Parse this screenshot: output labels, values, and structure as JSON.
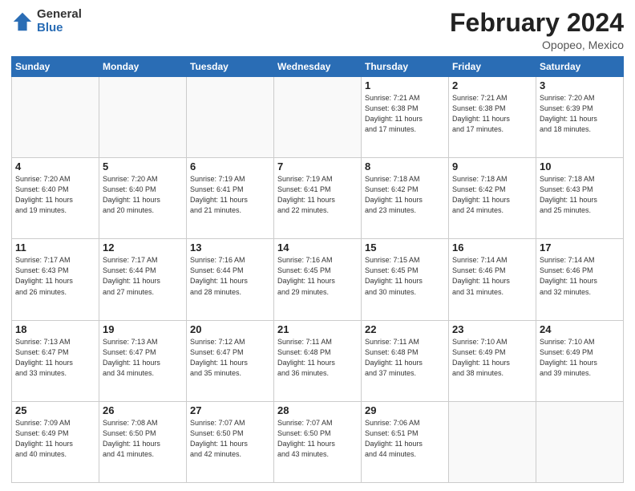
{
  "header": {
    "logo_general": "General",
    "logo_blue": "Blue",
    "title": "February 2024",
    "location": "Opopeo, Mexico"
  },
  "days_of_week": [
    "Sunday",
    "Monday",
    "Tuesday",
    "Wednesday",
    "Thursday",
    "Friday",
    "Saturday"
  ],
  "weeks": [
    [
      {
        "day": "",
        "info": ""
      },
      {
        "day": "",
        "info": ""
      },
      {
        "day": "",
        "info": ""
      },
      {
        "day": "",
        "info": ""
      },
      {
        "day": "1",
        "info": "Sunrise: 7:21 AM\nSunset: 6:38 PM\nDaylight: 11 hours\nand 17 minutes."
      },
      {
        "day": "2",
        "info": "Sunrise: 7:21 AM\nSunset: 6:38 PM\nDaylight: 11 hours\nand 17 minutes."
      },
      {
        "day": "3",
        "info": "Sunrise: 7:20 AM\nSunset: 6:39 PM\nDaylight: 11 hours\nand 18 minutes."
      }
    ],
    [
      {
        "day": "4",
        "info": "Sunrise: 7:20 AM\nSunset: 6:40 PM\nDaylight: 11 hours\nand 19 minutes."
      },
      {
        "day": "5",
        "info": "Sunrise: 7:20 AM\nSunset: 6:40 PM\nDaylight: 11 hours\nand 20 minutes."
      },
      {
        "day": "6",
        "info": "Sunrise: 7:19 AM\nSunset: 6:41 PM\nDaylight: 11 hours\nand 21 minutes."
      },
      {
        "day": "7",
        "info": "Sunrise: 7:19 AM\nSunset: 6:41 PM\nDaylight: 11 hours\nand 22 minutes."
      },
      {
        "day": "8",
        "info": "Sunrise: 7:18 AM\nSunset: 6:42 PM\nDaylight: 11 hours\nand 23 minutes."
      },
      {
        "day": "9",
        "info": "Sunrise: 7:18 AM\nSunset: 6:42 PM\nDaylight: 11 hours\nand 24 minutes."
      },
      {
        "day": "10",
        "info": "Sunrise: 7:18 AM\nSunset: 6:43 PM\nDaylight: 11 hours\nand 25 minutes."
      }
    ],
    [
      {
        "day": "11",
        "info": "Sunrise: 7:17 AM\nSunset: 6:43 PM\nDaylight: 11 hours\nand 26 minutes."
      },
      {
        "day": "12",
        "info": "Sunrise: 7:17 AM\nSunset: 6:44 PM\nDaylight: 11 hours\nand 27 minutes."
      },
      {
        "day": "13",
        "info": "Sunrise: 7:16 AM\nSunset: 6:44 PM\nDaylight: 11 hours\nand 28 minutes."
      },
      {
        "day": "14",
        "info": "Sunrise: 7:16 AM\nSunset: 6:45 PM\nDaylight: 11 hours\nand 29 minutes."
      },
      {
        "day": "15",
        "info": "Sunrise: 7:15 AM\nSunset: 6:45 PM\nDaylight: 11 hours\nand 30 minutes."
      },
      {
        "day": "16",
        "info": "Sunrise: 7:14 AM\nSunset: 6:46 PM\nDaylight: 11 hours\nand 31 minutes."
      },
      {
        "day": "17",
        "info": "Sunrise: 7:14 AM\nSunset: 6:46 PM\nDaylight: 11 hours\nand 32 minutes."
      }
    ],
    [
      {
        "day": "18",
        "info": "Sunrise: 7:13 AM\nSunset: 6:47 PM\nDaylight: 11 hours\nand 33 minutes."
      },
      {
        "day": "19",
        "info": "Sunrise: 7:13 AM\nSunset: 6:47 PM\nDaylight: 11 hours\nand 34 minutes."
      },
      {
        "day": "20",
        "info": "Sunrise: 7:12 AM\nSunset: 6:47 PM\nDaylight: 11 hours\nand 35 minutes."
      },
      {
        "day": "21",
        "info": "Sunrise: 7:11 AM\nSunset: 6:48 PM\nDaylight: 11 hours\nand 36 minutes."
      },
      {
        "day": "22",
        "info": "Sunrise: 7:11 AM\nSunset: 6:48 PM\nDaylight: 11 hours\nand 37 minutes."
      },
      {
        "day": "23",
        "info": "Sunrise: 7:10 AM\nSunset: 6:49 PM\nDaylight: 11 hours\nand 38 minutes."
      },
      {
        "day": "24",
        "info": "Sunrise: 7:10 AM\nSunset: 6:49 PM\nDaylight: 11 hours\nand 39 minutes."
      }
    ],
    [
      {
        "day": "25",
        "info": "Sunrise: 7:09 AM\nSunset: 6:49 PM\nDaylight: 11 hours\nand 40 minutes."
      },
      {
        "day": "26",
        "info": "Sunrise: 7:08 AM\nSunset: 6:50 PM\nDaylight: 11 hours\nand 41 minutes."
      },
      {
        "day": "27",
        "info": "Sunrise: 7:07 AM\nSunset: 6:50 PM\nDaylight: 11 hours\nand 42 minutes."
      },
      {
        "day": "28",
        "info": "Sunrise: 7:07 AM\nSunset: 6:50 PM\nDaylight: 11 hours\nand 43 minutes."
      },
      {
        "day": "29",
        "info": "Sunrise: 7:06 AM\nSunset: 6:51 PM\nDaylight: 11 hours\nand 44 minutes."
      },
      {
        "day": "",
        "info": ""
      },
      {
        "day": "",
        "info": ""
      }
    ]
  ]
}
